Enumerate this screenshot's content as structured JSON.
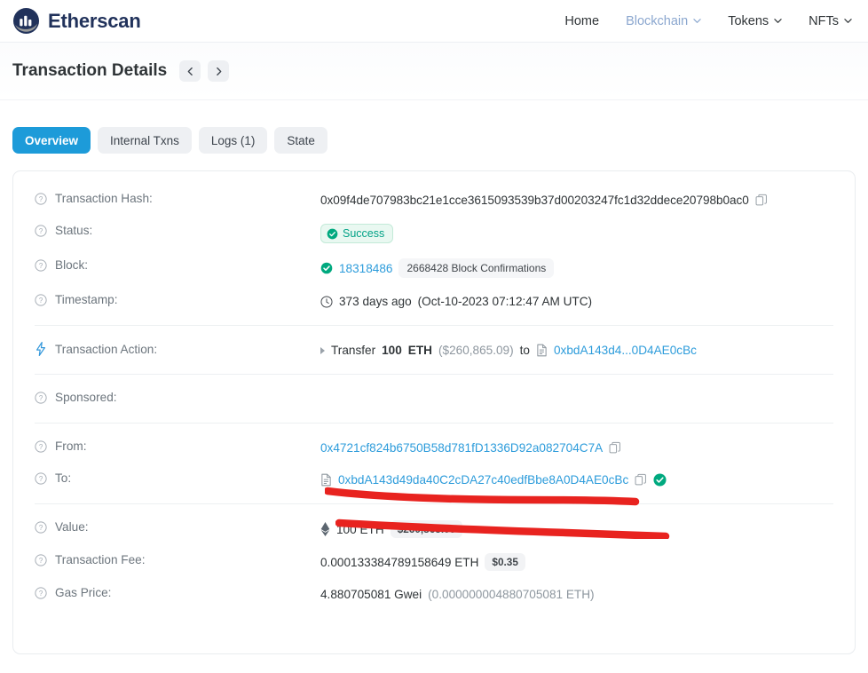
{
  "header": {
    "brand": "Etherscan",
    "brand_logo_icon": "etherscan-logo-icon",
    "nav": [
      {
        "label": "Home",
        "icon": null,
        "active": false
      },
      {
        "label": "Blockchain",
        "icon": "chevron-down-icon",
        "active": true
      },
      {
        "label": "Tokens",
        "icon": "chevron-down-icon",
        "active": false
      },
      {
        "label": "NFTs",
        "icon": "chevron-down-icon",
        "active": false
      }
    ]
  },
  "titlebar": {
    "title": "Transaction Details",
    "prev_icon": "chevron-left-icon",
    "next_icon": "chevron-right-icon"
  },
  "tabs": [
    {
      "label": "Overview",
      "active": true
    },
    {
      "label": "Internal Txns",
      "active": false
    },
    {
      "label": "Logs (1)",
      "active": false
    },
    {
      "label": "State",
      "active": false
    }
  ],
  "details": {
    "transaction_hash": {
      "label": "Transaction Hash:",
      "value": "0x09f4de707983bc21e1cce3615093539b37d00203247fc1d32ddece20798b0ac0",
      "copy_icon": "copy-icon"
    },
    "status": {
      "label": "Status:",
      "value": "Success",
      "badge_icon": "check-circle-icon"
    },
    "block": {
      "label": "Block:",
      "value": "18318486",
      "confirmations": "2668428 Block Confirmations",
      "check_icon": "check-circle-icon"
    },
    "timestamp": {
      "label": "Timestamp:",
      "relative": "373 days ago",
      "absolute": "(Oct-10-2023 07:12:47 AM UTC)",
      "clock_icon": "clock-icon"
    },
    "transaction_action": {
      "label": "Transaction Action:",
      "bolt_icon": "lightning-bolt-icon",
      "verb": "Transfer",
      "amount": "100",
      "currency": "ETH",
      "usd": "($260,865.09)",
      "preposition": "to",
      "target": "0xbdA143d4...0D4AE0cBc",
      "doc_icon": "contract-doc-icon"
    },
    "sponsored": {
      "label": "Sponsored:",
      "value": ""
    },
    "from": {
      "label": "From:",
      "value": "0x4721cf824b6750B58d781fD1336D92a082704C7A",
      "copy_icon": "copy-icon",
      "annotation": "red-underline-stroke"
    },
    "to": {
      "label": "To:",
      "value": "0xbdA143d49da40C2cDA27c40edfBbe8A0D4AE0cBc",
      "doc_icon": "contract-doc-icon",
      "copy_icon": "copy-icon",
      "verified_icon": "verified-check-icon",
      "annotation": "red-underline-stroke"
    },
    "value": {
      "label": "Value:",
      "eth_icon": "ethereum-diamond-icon",
      "amount": "100 ETH",
      "usd": "$260,865.09"
    },
    "transaction_fee": {
      "label": "Transaction Fee:",
      "amount": "0.000133384789158649 ETH",
      "usd": "$0.35"
    },
    "gas_price": {
      "label": "Gas Price:",
      "gwei": "4.880705081 Gwei",
      "eth": "(0.000000004880705081 ETH)"
    }
  },
  "colors": {
    "brand_navy": "#21325b",
    "link_blue": "#2d9cdb",
    "tab_active": "#1d9bd9",
    "success_green": "#00a186",
    "annotation_red": "#e8231f"
  }
}
